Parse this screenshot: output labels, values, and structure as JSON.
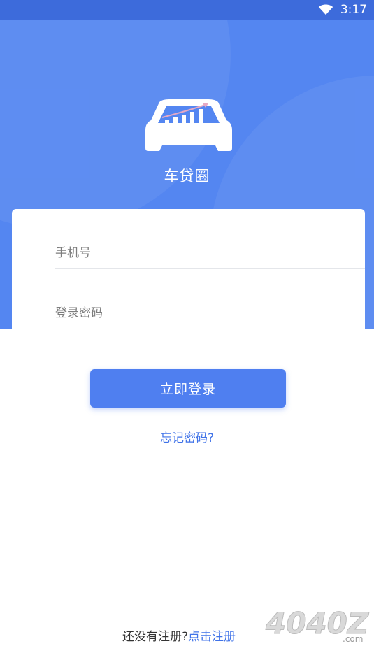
{
  "status_bar": {
    "time": "3:17",
    "wifi_icon": "wifi-icon"
  },
  "app": {
    "name": "车贷圈",
    "logo_icon": "car-chart-logo-icon"
  },
  "form": {
    "phone_placeholder": "手机号",
    "phone_value": "",
    "password_placeholder": "登录密码",
    "password_value": ""
  },
  "actions": {
    "login_label": "立即登录",
    "forgot_label": "忘记密码?",
    "register_prompt": "还没有注册?",
    "register_link": "点击注册"
  },
  "watermark": {
    "text": "4040Z",
    "domain": ".com"
  },
  "colors": {
    "primary": "#5486f1",
    "button": "#4f7ff0",
    "link": "#3f72e8"
  }
}
